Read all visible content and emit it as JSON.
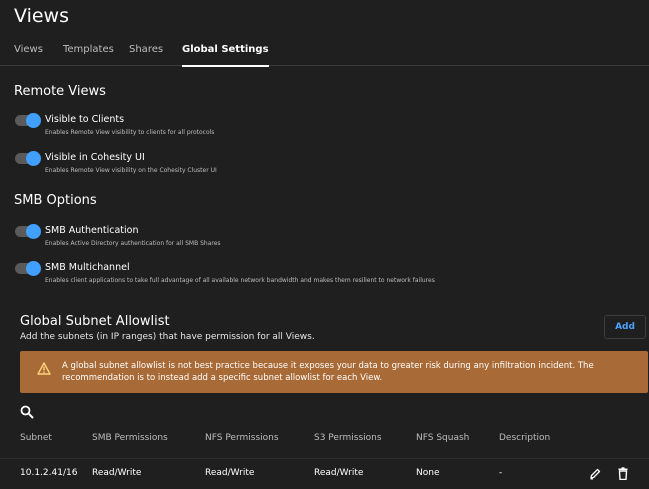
{
  "page": {
    "title": "Views"
  },
  "tabs": [
    {
      "label": "Views"
    },
    {
      "label": "Templates"
    },
    {
      "label": "Shares"
    },
    {
      "label": "Global Settings",
      "active": true
    }
  ],
  "remote_views": {
    "title": "Remote Views",
    "toggles": [
      {
        "label": "Visible to Clients",
        "desc": "Enables Remote View visibility to clients for all protocols",
        "on": true
      },
      {
        "label": "Visible in Cohesity UI",
        "desc": "Enables Remote View visibility on the Cohesity Cluster UI",
        "on": true
      }
    ]
  },
  "smb_options": {
    "title": "SMB Options",
    "toggles": [
      {
        "label": "SMB Authentication",
        "desc": "Enables Active Directory authentication for all SMB Shares",
        "on": true
      },
      {
        "label": "SMB Multichannel",
        "desc": "Enables client applications to take full advantage of all available network bandwidth and makes them resilient to network failures",
        "on": true
      }
    ]
  },
  "allowlist": {
    "title": "Global Subnet Allowlist",
    "subtitle": "Add the subnets (in IP ranges) that have permission for all Views.",
    "add_label": "Add",
    "warning": "A global subnet allowlist is not best practice because it exposes your data to greater risk during any infiltration incident. The recommendation is to instead add a specific subnet allowlist for each View.",
    "columns": [
      "Subnet",
      "SMB Permissions",
      "NFS Permissions",
      "S3 Permissions",
      "NFS Squash",
      "Description"
    ],
    "rows": [
      {
        "subnet": "10.1.2.41/16",
        "smb": "Read/Write",
        "nfs": "Read/Write",
        "s3": "Read/Write",
        "squash": "None",
        "description": "-"
      }
    ]
  },
  "colors": {
    "background": "#1f1f1f",
    "accent": "#41a0ff",
    "warning": "#a86a36"
  },
  "icons": [
    "warning-icon",
    "search-icon",
    "edit-icon",
    "delete-icon"
  ]
}
